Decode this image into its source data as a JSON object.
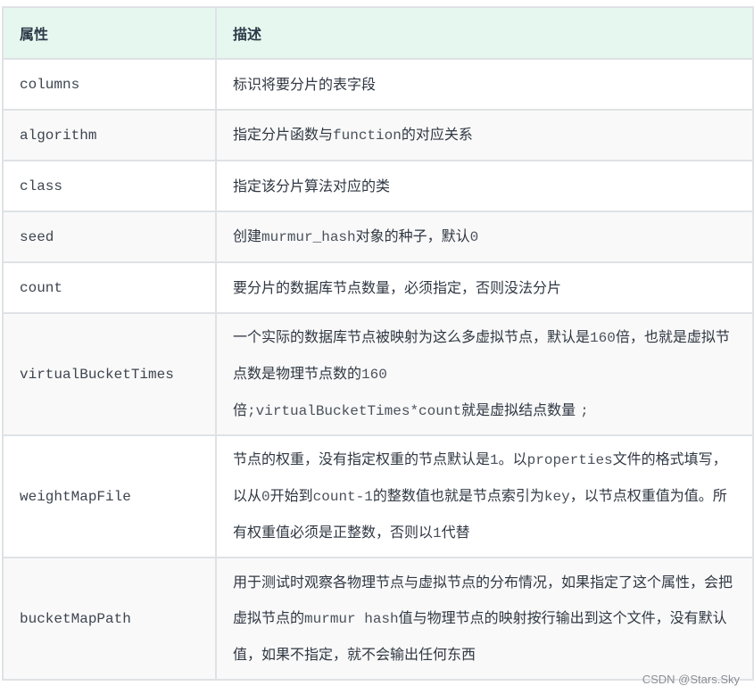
{
  "table": {
    "headers": {
      "property": "属性",
      "description": "描述"
    },
    "rows": [
      {
        "property": "columns",
        "description": [
          {
            "t": "text",
            "v": "标识将要分片的表字段"
          }
        ]
      },
      {
        "property": "algorithm",
        "description": [
          {
            "t": "text",
            "v": "指定分片函数与"
          },
          {
            "t": "code",
            "v": "function"
          },
          {
            "t": "text",
            "v": "的对应关系"
          }
        ]
      },
      {
        "property": "class",
        "description": [
          {
            "t": "text",
            "v": "指定该分片算法对应的类"
          }
        ]
      },
      {
        "property": "seed",
        "description": [
          {
            "t": "text",
            "v": "创建"
          },
          {
            "t": "code",
            "v": "murmur_hash"
          },
          {
            "t": "text",
            "v": "对象的种子，默认"
          },
          {
            "t": "code",
            "v": "0"
          }
        ]
      },
      {
        "property": "count",
        "description": [
          {
            "t": "text",
            "v": "要分片的数据库节点数量，必须指定，否则没法分片"
          }
        ]
      },
      {
        "property": "virtualBucketTimes",
        "description": [
          {
            "t": "text",
            "v": "一个实际的数据库节点被映射为这么多虚拟节点，默认是"
          },
          {
            "t": "code",
            "v": "160"
          },
          {
            "t": "text",
            "v": "倍，也就是虚拟节点数是物理节点数的"
          },
          {
            "t": "code",
            "v": "160"
          },
          {
            "t": "br",
            "v": ""
          },
          {
            "t": "text",
            "v": "倍"
          },
          {
            "t": "code",
            "v": ";virtualBucketTimes*count"
          },
          {
            "t": "text",
            "v": "就是虚拟结点数量 "
          },
          {
            "t": "code",
            "v": ";"
          }
        ]
      },
      {
        "property": "weightMapFile",
        "description": [
          {
            "t": "text",
            "v": "节点的权重，没有指定权重的节点默认是"
          },
          {
            "t": "code",
            "v": "1"
          },
          {
            "t": "text",
            "v": "。以"
          },
          {
            "t": "code",
            "v": "properties"
          },
          {
            "t": "text",
            "v": "文件的格式填写，以从"
          },
          {
            "t": "code",
            "v": "0"
          },
          {
            "t": "text",
            "v": "开始到"
          },
          {
            "t": "code",
            "v": "count-1"
          },
          {
            "t": "text",
            "v": "的整数值也就是节点索引为"
          },
          {
            "t": "code",
            "v": "key"
          },
          {
            "t": "text",
            "v": "，以节点权重值为值。所有权重值必须是正整数，否则以"
          },
          {
            "t": "code",
            "v": "1"
          },
          {
            "t": "text",
            "v": "代替"
          }
        ]
      },
      {
        "property": "bucketMapPath",
        "description": [
          {
            "t": "text",
            "v": "用于测试时观察各物理节点与虚拟节点的分布情况，如果指定了这个属性，会把虚拟节点的"
          },
          {
            "t": "code",
            "v": "murmur hash"
          },
          {
            "t": "text",
            "v": "值与物理节点的映射按行输出到这个文件，没有默认值，如果不指定，就不会输出任何东西"
          }
        ]
      }
    ]
  },
  "watermark": "CSDN @Stars.Sky"
}
